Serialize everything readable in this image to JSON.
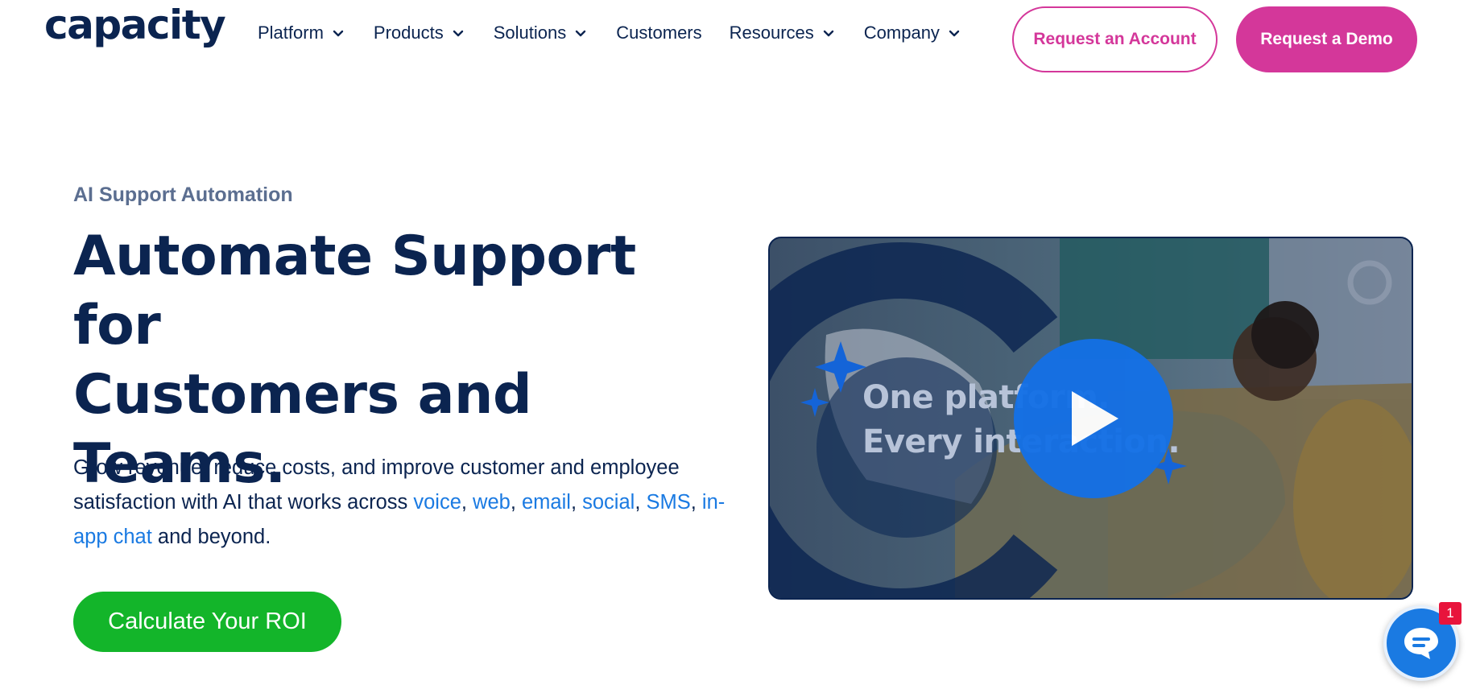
{
  "brand": {
    "logo_text": "capacity",
    "colors": {
      "navy": "#0b2450",
      "pink": "#d4379a",
      "green": "#13b52a",
      "link_blue": "#1a7ae2"
    }
  },
  "nav": {
    "items": [
      {
        "label": "Platform",
        "has_dropdown": true
      },
      {
        "label": "Products",
        "has_dropdown": true
      },
      {
        "label": "Solutions",
        "has_dropdown": true
      },
      {
        "label": "Customers",
        "has_dropdown": false
      },
      {
        "label": "Resources",
        "has_dropdown": true
      },
      {
        "label": "Company",
        "has_dropdown": true
      }
    ],
    "request_account": "Request an Account",
    "request_demo": "Request a Demo"
  },
  "hero": {
    "eyebrow": "AI Support Automation",
    "headline_1": "Automate Support for",
    "headline_2": "Customers and",
    "headline_3": "Teams.",
    "body": {
      "t1": "Grow revenue, reduce costs, and improve customer and employee satisfaction with AI that works across ",
      "link_voice": "voice",
      "sep1": ", ",
      "link_web": "web",
      "sep2": ", ",
      "link_email": "email",
      "sep3": ", ",
      "link_social": "social",
      "sep4": ", ",
      "link_sms": "SMS",
      "sep5": ", ",
      "link_inapp": "in-app chat",
      "t2": " and beyond."
    },
    "cta": "Calculate Your ROI"
  },
  "video": {
    "line1": "One platform.",
    "line2": "Every interaction.",
    "icons": [
      "play-icon",
      "capacity-watermark-icon"
    ]
  },
  "chat": {
    "badge_count": "1",
    "icon": "chat-bubble-icon"
  }
}
